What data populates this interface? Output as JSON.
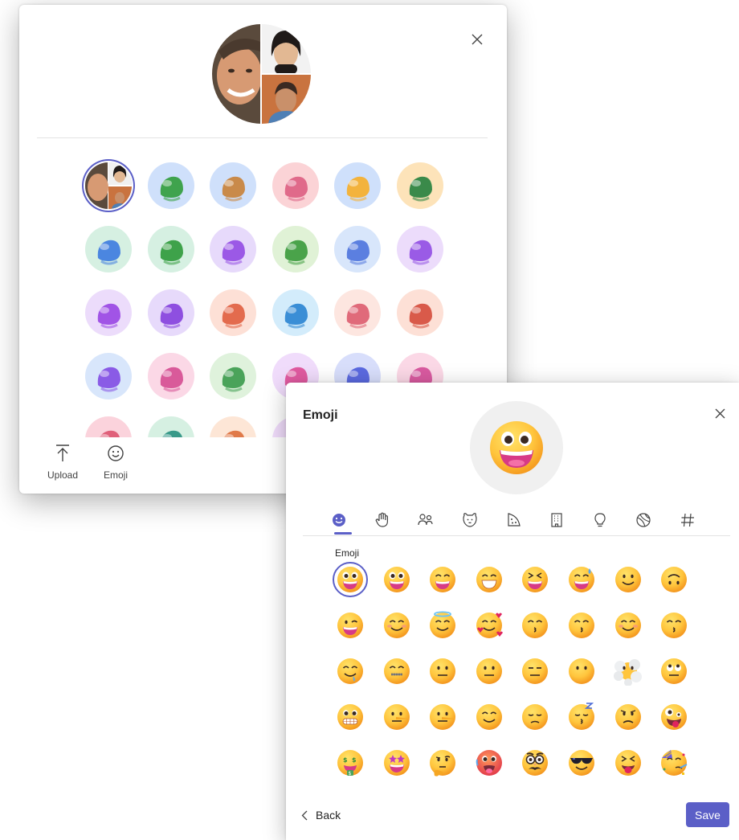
{
  "avatar_picker": {
    "tools": [
      {
        "label": "Upload",
        "icon": "upload-icon"
      },
      {
        "label": "Emoji",
        "icon": "emoji-icon"
      }
    ],
    "options": [
      {
        "name": "avatar-group-photo",
        "bg": "#ffffff",
        "c": "#8b6a52"
      },
      {
        "name": "avatar-camping",
        "bg": "#cfe0fb",
        "c": "#3fa34d"
      },
      {
        "name": "avatar-dog",
        "bg": "#cfe0fb",
        "c": "#c98a4a"
      },
      {
        "name": "avatar-robot",
        "bg": "#fbd3d6",
        "c": "#e06a8a"
      },
      {
        "name": "avatar-thinking-face",
        "bg": "#cfe0fb",
        "c": "#f3b33d"
      },
      {
        "name": "avatar-beetle",
        "bg": "#fde3b9",
        "c": "#3a8a4a"
      },
      {
        "name": "avatar-hands-touch",
        "bg": "#d6f0e2",
        "c": "#4b86e0"
      },
      {
        "name": "avatar-sprout",
        "bg": "#d6f0e2",
        "c": "#3ea24a"
      },
      {
        "name": "avatar-flame-hands",
        "bg": "#e7dafb",
        "c": "#9b59e6"
      },
      {
        "name": "avatar-star-hand",
        "bg": "#e0f2d6",
        "c": "#4aa34a"
      },
      {
        "name": "avatar-handshake",
        "bg": "#d8e6fb",
        "c": "#5b7fe0"
      },
      {
        "name": "avatar-heart-hands",
        "bg": "#ecdcfb",
        "c": "#9a5be6"
      },
      {
        "name": "avatar-monster",
        "bg": "#ecdcfb",
        "c": "#a154e6"
      },
      {
        "name": "avatar-octopus",
        "bg": "#e7dafb",
        "c": "#8e4fe0"
      },
      {
        "name": "avatar-cookie",
        "bg": "#fde0d6",
        "c": "#e36b4e"
      },
      {
        "name": "avatar-cat-bucket",
        "bg": "#d3ecfb",
        "c": "#3a8ed6"
      },
      {
        "name": "avatar-potions",
        "bg": "#fde6e0",
        "c": "#e06a7a"
      },
      {
        "name": "avatar-ice-cream",
        "bg": "#fde0d6",
        "c": "#d95a4a"
      },
      {
        "name": "avatar-camera",
        "bg": "#d8e6fb",
        "c": "#8a5be6"
      },
      {
        "name": "avatar-calendar",
        "bg": "#fbd8e6",
        "c": "#d95a9a"
      },
      {
        "name": "avatar-rocket",
        "bg": "#dff2dc",
        "c": "#4aa35a"
      },
      {
        "name": "avatar-teacup",
        "bg": "#f0dcfb",
        "c": "#e05aa0"
      },
      {
        "name": "avatar-bell",
        "bg": "#d8defb",
        "c": "#5b6ae0"
      },
      {
        "name": "avatar-boombox",
        "bg": "#fbd8e6",
        "c": "#d95aa0"
      },
      {
        "name": "avatar-heart",
        "bg": "#fbd3dc",
        "c": "#e0607a"
      },
      {
        "name": "avatar-film",
        "bg": "#d6f0e2",
        "c": "#3a9a8a"
      },
      {
        "name": "avatar-balloon",
        "bg": "#fde6d6",
        "c": "#e07a4a"
      },
      {
        "name": "avatar-partial",
        "bg": "#f0dcfb",
        "c": "#b57ae6"
      }
    ]
  },
  "emoji_picker": {
    "title": "Emoji",
    "section_label": "Emoji",
    "back_label": "Back",
    "save_label": "Save",
    "accent": "#5b5fc7",
    "categories": [
      {
        "icon": "smiley-icon"
      },
      {
        "icon": "hand-icon"
      },
      {
        "icon": "people-icon"
      },
      {
        "icon": "animal-icon"
      },
      {
        "icon": "food-icon"
      },
      {
        "icon": "building-icon"
      },
      {
        "icon": "lightbulb-icon"
      },
      {
        "icon": "ball-icon"
      },
      {
        "icon": "hashtag-icon"
      }
    ],
    "emojis": [
      {
        "name": "grinning-face-big-eyes",
        "v": "grin"
      },
      {
        "name": "grinning-face-wide",
        "v": "grin"
      },
      {
        "name": "grinning-face-smiling-eyes",
        "v": "smile"
      },
      {
        "name": "beaming-face",
        "v": "beam"
      },
      {
        "name": "squinting-laughing-face",
        "v": "squint"
      },
      {
        "name": "grinning-face-sweat",
        "v": "sweat"
      },
      {
        "name": "slightly-smiling-face",
        "v": "slight"
      },
      {
        "name": "upside-down-face",
        "v": "upside"
      },
      {
        "name": "winking-face",
        "v": "wink"
      },
      {
        "name": "smiling-face-smiling-eyes",
        "v": "blush"
      },
      {
        "name": "smiling-face-halo",
        "v": "halo"
      },
      {
        "name": "smiling-face-hearts",
        "v": "hearts"
      },
      {
        "name": "face-blowing-kiss",
        "v": "kiss"
      },
      {
        "name": "kissing-face",
        "v": "kiss"
      },
      {
        "name": "smiling-face",
        "v": "blush"
      },
      {
        "name": "kissing-face-smiling-eyes",
        "v": "kiss"
      },
      {
        "name": "drooling-face",
        "v": "drool"
      },
      {
        "name": "zipper-mouth-face",
        "v": "zip"
      },
      {
        "name": "face-raised-eyebrow",
        "v": "neutral"
      },
      {
        "name": "neutral-face",
        "v": "neutral"
      },
      {
        "name": "expressionless-face",
        "v": "flat"
      },
      {
        "name": "face-without-mouth",
        "v": "nomouth"
      },
      {
        "name": "face-in-clouds",
        "v": "cloud"
      },
      {
        "name": "face-rolling-eyes",
        "v": "roll"
      },
      {
        "name": "grimacing-face",
        "v": "grimace"
      },
      {
        "name": "lying-face",
        "v": "lie"
      },
      {
        "name": "pinocchio-face",
        "v": "lie"
      },
      {
        "name": "relieved-face",
        "v": "relieved"
      },
      {
        "name": "pensive-face",
        "v": "pensive"
      },
      {
        "name": "sleeping-face",
        "v": "sleep"
      },
      {
        "name": "worried-face",
        "v": "worried"
      },
      {
        "name": "zany-face",
        "v": "zany"
      },
      {
        "name": "money-mouth-face",
        "v": "money"
      },
      {
        "name": "star-struck",
        "v": "star"
      },
      {
        "name": "thinking-face",
        "v": "think"
      },
      {
        "name": "hot-face",
        "v": "hot"
      },
      {
        "name": "disguised-face",
        "v": "disguise"
      },
      {
        "name": "smiling-face-sunglasses",
        "v": "cool"
      },
      {
        "name": "squinting-tongue-face",
        "v": "tongue"
      },
      {
        "name": "partying-face",
        "v": "party"
      }
    ]
  }
}
